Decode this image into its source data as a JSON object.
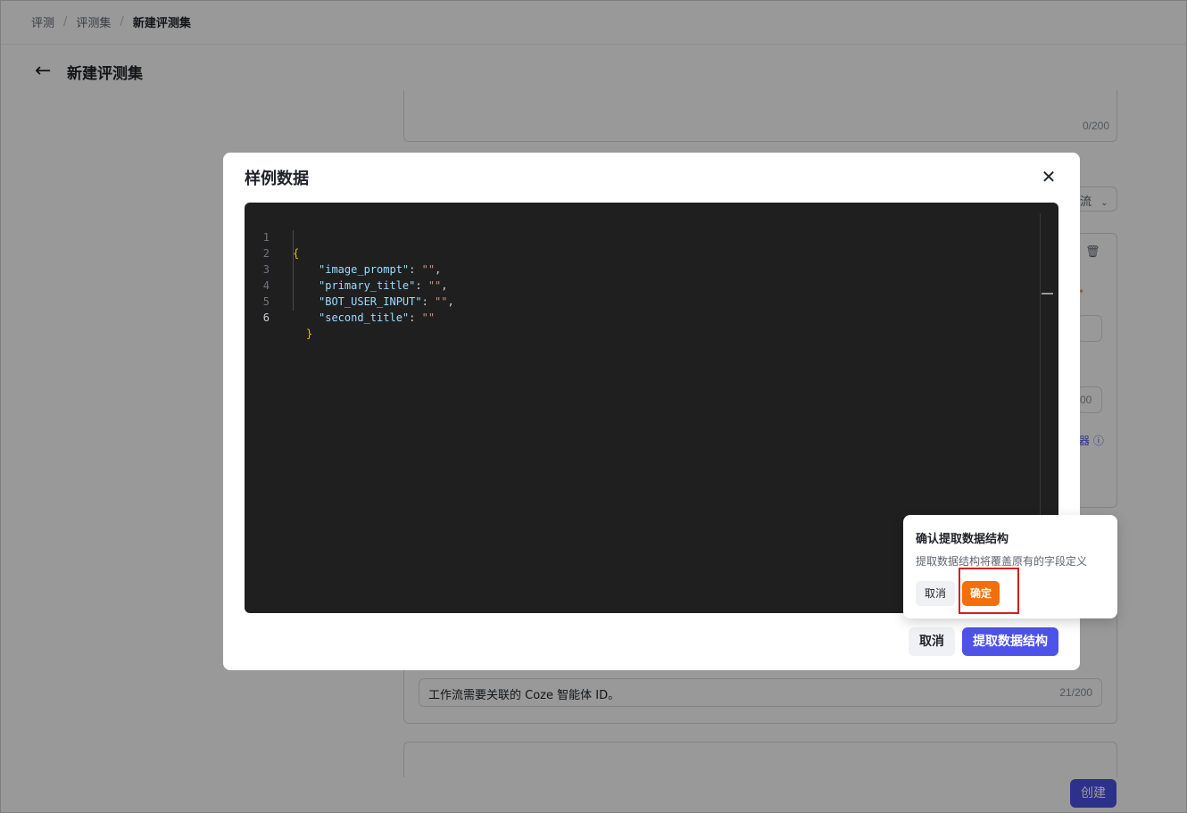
{
  "breadcrumb": {
    "items": [
      "评测",
      "评测集",
      "新建评测集"
    ]
  },
  "header": {
    "title": "新建评测集"
  },
  "background": {
    "desc_counter": "0/200",
    "select_partial": "流",
    "number_partial": "00",
    "info_partial": "器",
    "field_value": "工作流需要关联的 Coze 智能体 ID。",
    "field_counter": "21/200",
    "create_label": "创建"
  },
  "modal": {
    "title": "样例数据",
    "cancel_label": "取消",
    "extract_label": "提取数据结构",
    "code": {
      "line_numbers": [
        "1",
        "2",
        "3",
        "4",
        "5",
        "6"
      ],
      "open_brace": "{",
      "close_brace": "}",
      "fields": [
        {
          "key": "\"image_prompt\"",
          "value": "\"\"",
          "trail": ","
        },
        {
          "key": "\"primary_title\"",
          "value": "\"\"",
          "trail": ","
        },
        {
          "key": "\"BOT_USER_INPUT\"",
          "value": "\"\"",
          "trail": ","
        },
        {
          "key": "\"second_title\"",
          "value": "\"\"",
          "trail": ""
        }
      ]
    }
  },
  "popconfirm": {
    "title": "确认提取数据结构",
    "description": "提取数据结构将覆盖原有的字段定义",
    "cancel_label": "取消",
    "confirm_label": "确定"
  },
  "colors": {
    "accent": "#4d53e8",
    "confirm": "#f46f0a",
    "highlight": "#d41f1f"
  }
}
